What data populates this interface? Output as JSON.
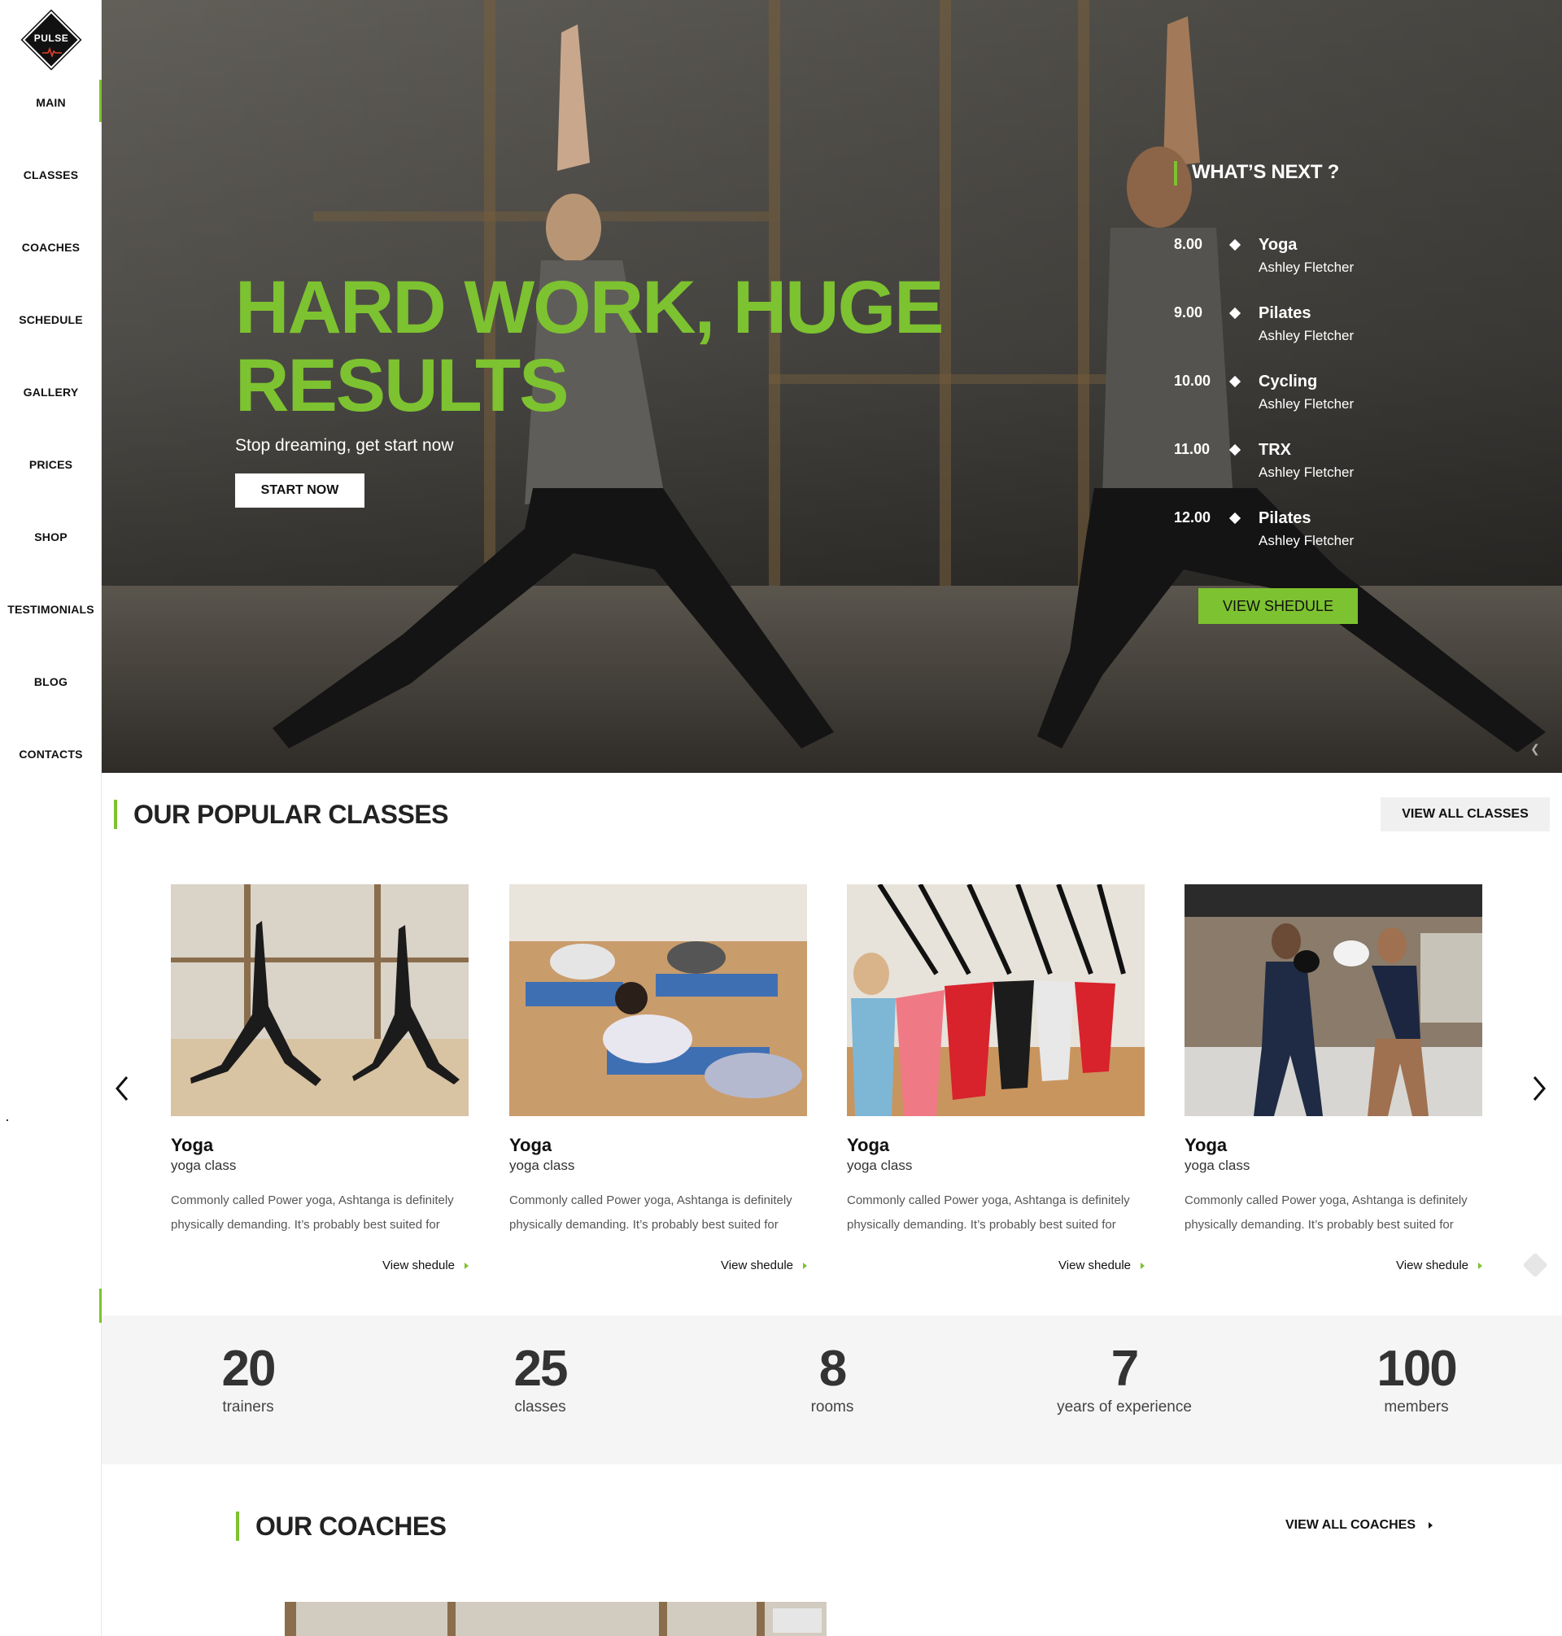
{
  "brand": {
    "logo_text": "PULSE",
    "accent_color": "#7dc230"
  },
  "nav": {
    "items": [
      {
        "label": "MAIN",
        "active": true
      },
      {
        "label": "CLASSES"
      },
      {
        "label": "COACHES"
      },
      {
        "label": "SCHEDULE"
      },
      {
        "label": "GALLERY"
      },
      {
        "label": "PRICES"
      },
      {
        "label": "SHOP"
      },
      {
        "label": "TESTIMONIALS"
      },
      {
        "label": "BLOG"
      },
      {
        "label": "CONTACTS"
      }
    ]
  },
  "hero": {
    "title_line1": "HARD WORK, HUGE",
    "title_line2": "RESULTS",
    "subtitle": "Stop dreaming, get start now",
    "cta_label": "START NOW"
  },
  "whats_next": {
    "title": "WHAT’S NEXT ?",
    "items": [
      {
        "time": "8.00",
        "class": "Yoga",
        "coach": "Ashley Fletcher"
      },
      {
        "time": "9.00",
        "class": "Pilates",
        "coach": "Ashley Fletcher"
      },
      {
        "time": "10.00",
        "class": "Cycling",
        "coach": "Ashley Fletcher"
      },
      {
        "time": "11.00",
        "class": "TRX",
        "coach": "Ashley Fletcher"
      },
      {
        "time": "12.00",
        "class": "Pilates",
        "coach": "Ashley Fletcher"
      }
    ],
    "button_label": "VIEW SHEDULE"
  },
  "popular_classes": {
    "title": "OUR POPULAR CLASSES",
    "view_all_label": "VIEW ALL CLASSES",
    "cards": [
      {
        "name": "Yoga",
        "type": "yoga class",
        "desc_line1": "Commonly called Power yoga, Ashtanga is definitely",
        "desc_line2": "physically demanding. It’s probably best suited for",
        "link": "View shedule"
      },
      {
        "name": "Yoga",
        "type": "yoga class",
        "desc_line1": "Commonly called Power yoga, Ashtanga is definitely",
        "desc_line2": "physically demanding. It’s probably best suited for",
        "link": "View shedule"
      },
      {
        "name": "Yoga",
        "type": "yoga class",
        "desc_line1": "Commonly called Power yoga, Ashtanga is definitely",
        "desc_line2": "physically demanding. It’s probably best suited for",
        "link": "View shedule"
      },
      {
        "name": "Yoga",
        "type": "yoga class",
        "desc_line1": "Commonly called Power yoga, Ashtanga is definitely",
        "desc_line2": "physically demanding. It’s probably best suited for",
        "link": "View shedule"
      }
    ]
  },
  "stats": [
    {
      "value": "20",
      "label": "trainers"
    },
    {
      "value": "25",
      "label": "classes"
    },
    {
      "value": "8",
      "label": "rooms"
    },
    {
      "value": "7",
      "label": "years of experience"
    },
    {
      "value": "100",
      "label": "members"
    }
  ],
  "coaches": {
    "title": "OUR COACHES",
    "view_all_label": "VIEW ALL COACHES"
  }
}
